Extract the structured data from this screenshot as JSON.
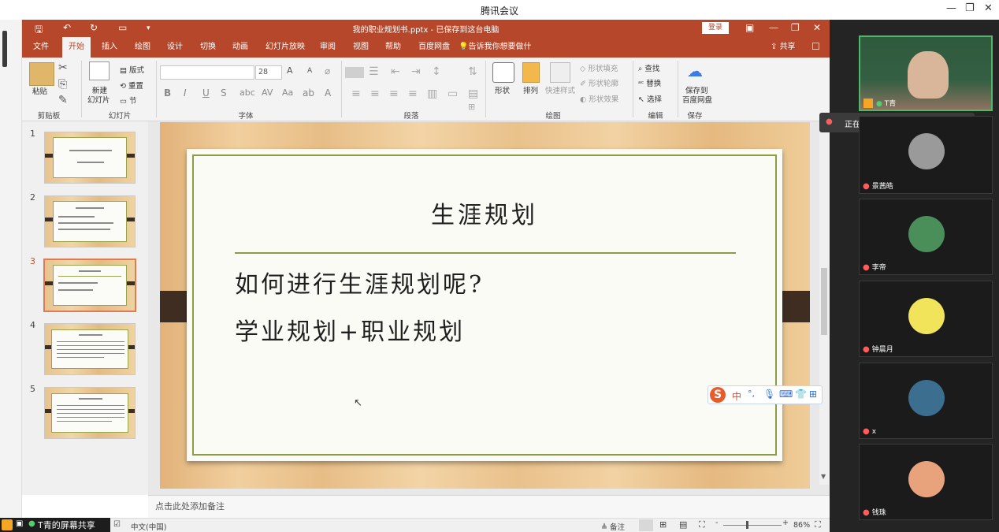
{
  "window": {
    "title": "腾讯会议"
  },
  "ppt": {
    "doc_title": "我的职业规划书.pptx - 已保存到这台电脑",
    "login_label": "登录",
    "tabs": [
      "文件",
      "开始",
      "插入",
      "绘图",
      "设计",
      "切换",
      "动画",
      "幻灯片放映",
      "审阅",
      "视图",
      "帮助",
      "百度网盘"
    ],
    "active_tab": "开始",
    "tell_me": "告诉我你想要做什么",
    "share_label": "共享",
    "ribbon": {
      "paste": "粘贴",
      "new_slide": "新建",
      "new_slide2": "幻灯片",
      "layout": "版式",
      "reset": "重置",
      "section": "节",
      "font_size": "28",
      "shape": "形状",
      "arrange": "排列",
      "quick_styles": "快速样式",
      "shape_fill": "形状填充",
      "shape_outline": "形状轮廓",
      "shape_effects": "形状效果",
      "find": "查找",
      "replace": "替换",
      "select": "选择",
      "save_baidu_1": "保存到",
      "save_baidu_2": "百度网盘",
      "groups": {
        "clipboard": "剪贴板",
        "slides": "幻灯片",
        "font": "字体",
        "paragraph": "段落",
        "drawing": "绘图",
        "editing": "编辑",
        "save": "保存"
      }
    },
    "thumbnails": [
      {
        "num": "1"
      },
      {
        "num": "2"
      },
      {
        "num": "3"
      },
      {
        "num": "4"
      },
      {
        "num": "5"
      }
    ],
    "selected_slide": 3,
    "slide": {
      "title": "生涯规划",
      "line1": "如何进行生涯规划呢?",
      "line2": "学业规划+职业规划"
    },
    "ime": {
      "mode": "中"
    },
    "notes_placeholder": "点击此处添加备注",
    "status": {
      "language": "中文(中国)",
      "notes": "备注",
      "zoom": "86%"
    }
  },
  "meeting": {
    "speaking_label": "正在讲话: T青;",
    "screen_share_label": "T青的屏幕共享",
    "participants": [
      {
        "name": "T青",
        "active": true
      },
      {
        "name": "景茜皓"
      },
      {
        "name": "李帝"
      },
      {
        "name": "钟晨月"
      },
      {
        "name": "x"
      },
      {
        "name": "钱珠"
      }
    ]
  }
}
